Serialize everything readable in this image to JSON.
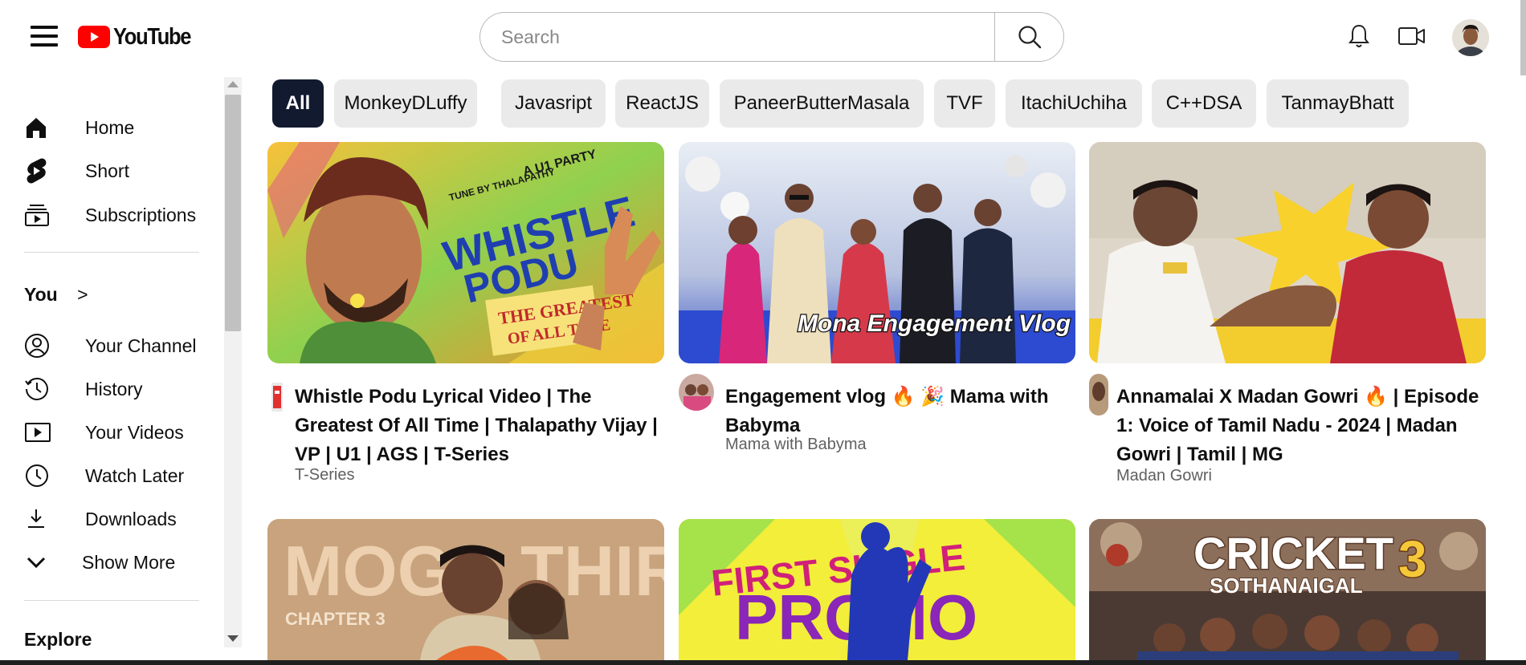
{
  "header": {
    "logo_text": "YouTube",
    "search_placeholder": "Search",
    "icons": [
      "menu-icon",
      "search-icon",
      "bell-icon",
      "video-camera-icon",
      "avatar"
    ]
  },
  "sidebar": {
    "main_items": [
      {
        "label": "Home",
        "icon": "home-icon"
      },
      {
        "label": "Short",
        "icon": "shorts-icon"
      },
      {
        "label": "Subscriptions",
        "icon": "subscriptions-icon"
      }
    ],
    "you_label": "You",
    "you_chevron": ">",
    "you_items": [
      {
        "label": "Your Channel",
        "icon": "channel-icon"
      },
      {
        "label": "History",
        "icon": "history-icon"
      },
      {
        "label": "Your Videos",
        "icon": "your-videos-icon"
      },
      {
        "label": "Watch Later",
        "icon": "watch-later-icon"
      },
      {
        "label": "Downloads",
        "icon": "download-icon"
      },
      {
        "label": "Show More",
        "icon": "chevron-down-icon"
      }
    ],
    "explore_label": "Explore"
  },
  "chips": [
    "All",
    "MonkeyDLuffy",
    "Javasript",
    "ReactJS",
    "PaneerButterMasala",
    "TVF",
    "ItachiUchiha",
    "C++DSA",
    "TanmayBhatt"
  ],
  "videos": [
    {
      "title": "Whistle Podu Lyrical Video | The Greatest Of All Time | Thalapathy Vijay | VP | U1 | AGS | T-Series",
      "channel": "T-Series",
      "thumb_text": {
        "line1": "WHISTLE",
        "line2": "PODU",
        "line3": "THE GREATEST",
        "line4": "OF ALL TIME",
        "tag1": "TUNE BY THALAPATHY",
        "tag2": "A U1 PARTY"
      }
    },
    {
      "title": "Engagement vlog 🔥 🎉 Mama with Babyma",
      "channel": "Mama with Babyma",
      "thumb_text": {
        "caption": "Mona Engagement Vlog"
      }
    },
    {
      "title": "Annamalai X Madan Gowri 🔥 | Episode 1: Voice of Tamil Nadu - 2024 | Madan Gowri | Tamil | MG",
      "channel": "Madan Gowri",
      "thumb_text": {}
    },
    {
      "title": "",
      "channel": "",
      "thumb_text": {
        "line1": "MOGA THIRAI",
        "line2": "CHAPTER 3"
      }
    },
    {
      "title": "",
      "channel": "",
      "thumb_text": {
        "line1": "FIRST SINGLE",
        "line2": "PROMO"
      }
    },
    {
      "title": "",
      "channel": "",
      "thumb_text": {
        "line1": "CRICKET",
        "line2": "SOTHANAIGAL",
        "line3": "3"
      }
    }
  ],
  "colors": {
    "brand_red": "#ff0000",
    "active_chip": "#111a2e",
    "chip_bg": "#eaeaea",
    "secondary_text": "#606060"
  }
}
